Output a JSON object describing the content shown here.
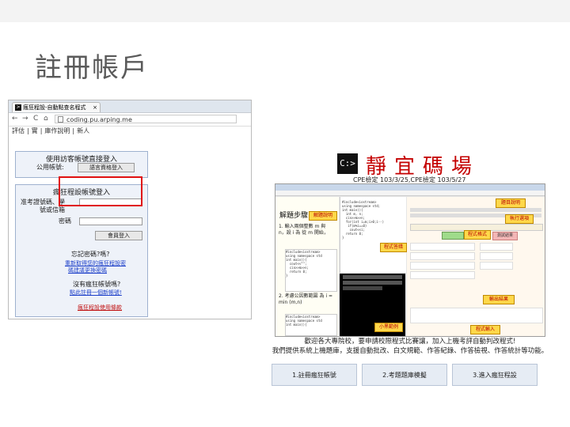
{
  "slide_title": "註冊帳戶",
  "left_browser": {
    "tab_label": "瘋狂程設-自動點查名程式",
    "tab_close": "×",
    "nav_back": "←",
    "nav_forward": "→",
    "nav_reload": "C",
    "nav_home": "⌂",
    "url": "coding.pu.arping.me",
    "menu_items": [
      "評估",
      "|",
      "實",
      "|",
      "庫作說明",
      "|",
      "新人"
    ],
    "guest_panel": {
      "title": "使用訪客帳號直接登入",
      "label": "公用帳號:",
      "button": "語言資格登入"
    },
    "login_panel": {
      "title": "瘋狂程設帳號登入",
      "row1_label": "准考證號碼、學",
      "row2_label": "號或信箱",
      "row3_label": "密碼",
      "button": "會員登入",
      "forgot_title": "忘記密碼?嗎?",
      "forgot_link1": "重新取得您的瘋狂程設密",
      "forgot_link2": "碼建議更換密碼",
      "signup_title": "沒有瘋狂帳號嗎?",
      "signup_link": "點此註冊一個新帳號!",
      "footer_link": "瘋狂程設使用條款"
    }
  },
  "right": {
    "logo_text": "C:>",
    "brand": "靜宜碼場",
    "subtitle": "CPE檢定 103/3/25,CPE檢定 103/5/27",
    "steps_heading": "解題步驟",
    "step1": "1. 輸入兩個整數 m 與 n，設 i 為 從 m 開始，",
    "step2": "2. 考慮公因數範圍 為 i = min (m,n)",
    "notes": {
      "read_problem": "題目說明",
      "problem_desc": "解題說明",
      "run_options": "執行選項",
      "run_result": "程式答錯",
      "test_result": "測試結果",
      "answer": "輸出結果",
      "format": "程式格式",
      "code_input": "程式輸入",
      "sample_output": "小黑範例"
    },
    "description_line1": "歡迎各大專院校，要申請校際程式比賽讓，加入上機考評自動判改程式!",
    "description_line2": "我們提供系統上機題庫，支援自動批改、白文規範、作答紀錄、作答檢視、作答統計等功能。",
    "buttons": [
      "1.註冊瘋狂帳號",
      "2.考題題庫模擬",
      "3.進入瘋狂程設"
    ]
  },
  "colors": {
    "brand_red": "#c40000",
    "highlight_red": "#e01010",
    "link_blue": "#1b3ec9",
    "panel_bg": "#eef2f9"
  }
}
